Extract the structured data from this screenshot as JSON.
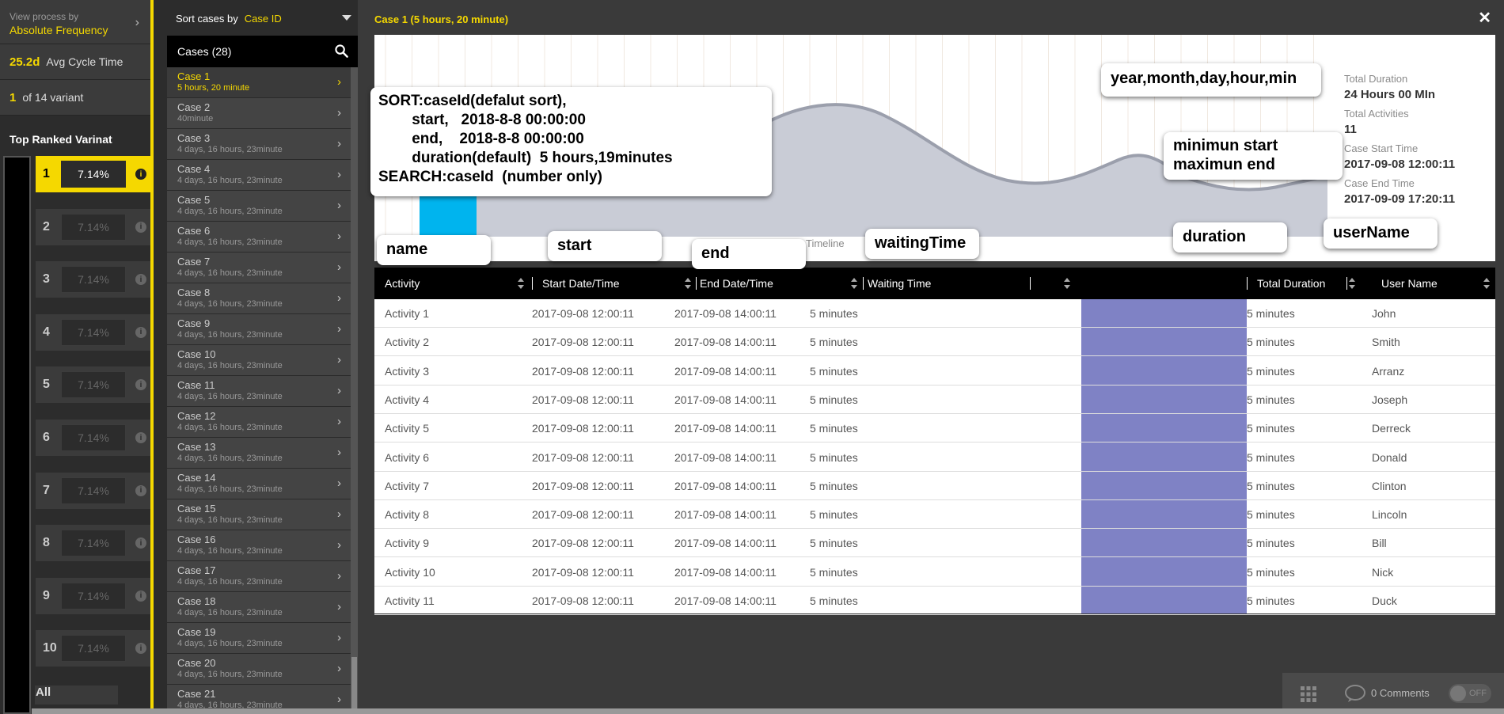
{
  "left": {
    "view_label": "View process by",
    "view_value": "Absolute Frequency",
    "avg_value": "25.2d",
    "avg_label": "Avg Cycle Time",
    "variant_num": "1",
    "variant_label": "of 14 variant",
    "top_ranked": "Top Ranked Varinat",
    "ranks": [
      {
        "n": "1",
        "pct": "7.14%"
      },
      {
        "n": "2",
        "pct": "7.14%"
      },
      {
        "n": "3",
        "pct": "7.14%"
      },
      {
        "n": "4",
        "pct": "7.14%"
      },
      {
        "n": "5",
        "pct": "7.14%"
      },
      {
        "n": "6",
        "pct": "7.14%"
      },
      {
        "n": "7",
        "pct": "7.14%"
      },
      {
        "n": "8",
        "pct": "7.14%"
      },
      {
        "n": "9",
        "pct": "7.14%"
      },
      {
        "n": "10",
        "pct": "7.14%"
      }
    ],
    "all_label": "All",
    "info_glyph": "i"
  },
  "cases": {
    "sort_label": "Sort cases by",
    "sort_value": "Case ID",
    "header": "Cases (28)",
    "items": [
      {
        "name": "Case 1",
        "dur": "5 hours, 20 minute"
      },
      {
        "name": "Case 2",
        "dur": "40minute"
      },
      {
        "name": "Case 3",
        "dur": "4 days, 16 hours, 23minute"
      },
      {
        "name": "Case 4",
        "dur": "4 days, 16 hours, 23minute"
      },
      {
        "name": "Case 5",
        "dur": "4 days, 16 hours, 23minute"
      },
      {
        "name": "Case 6",
        "dur": "4 days, 16 hours, 23minute"
      },
      {
        "name": "Case 7",
        "dur": "4 days, 16 hours, 23minute"
      },
      {
        "name": "Case 8",
        "dur": "4 days, 16 hours, 23minute"
      },
      {
        "name": "Case 9",
        "dur": "4 days, 16 hours, 23minute"
      },
      {
        "name": "Case 10",
        "dur": "4 days, 16 hours, 23minute"
      },
      {
        "name": "Case 11",
        "dur": "4 days, 16 hours, 23minute"
      },
      {
        "name": "Case 12",
        "dur": "4 days, 16 hours, 23minute"
      },
      {
        "name": "Case 13",
        "dur": "4 days, 16 hours, 23minute"
      },
      {
        "name": "Case 14",
        "dur": "4 days, 16 hours, 23minute"
      },
      {
        "name": "Case 15",
        "dur": "4 days, 16 hours, 23minute"
      },
      {
        "name": "Case 16",
        "dur": "4 days, 16 hours, 23minute"
      },
      {
        "name": "Case 17",
        "dur": "4 days, 16 hours, 23minute"
      },
      {
        "name": "Case 18",
        "dur": "4 days, 16 hours, 23minute"
      },
      {
        "name": "Case 19",
        "dur": "4 days, 16 hours, 23minute"
      },
      {
        "name": "Case 20",
        "dur": "4 days, 16 hours, 23minute"
      },
      {
        "name": "Case 21",
        "dur": "4 days, 16 hours, 23minute"
      }
    ],
    "arrow": "›"
  },
  "main": {
    "title": "Case 1 (5 hours, 20 minute)",
    "close": "✕",
    "timeline_label": "Timeline",
    "stats": [
      {
        "label": "Total Duration",
        "value": "24 Hours 00 MIn"
      },
      {
        "label": "Total Activities",
        "value": "11"
      },
      {
        "label": "Case Start Time",
        "value": "2017-09-08 12:00:11"
      },
      {
        "label": "Case End Time",
        "value": "2017-09-09 17:20:11"
      }
    ]
  },
  "annotations": {
    "sort_note": "SORT:caseId(defalut sort),\n        start,   2018-8-8 00:00:00\n        end,    2018-8-8 00:00:00\n        duration(default)  5 hours,19minutes\nSEARCH:caseId  (number only)",
    "format": "year,month,day,hour,min",
    "minmax": "minimun start\nmaximun end",
    "name": "name",
    "start": "start",
    "end": "end",
    "waiting": "waitingTime",
    "duration": "duration",
    "user": "userName"
  },
  "table": {
    "headers": {
      "activity": "Activity",
      "start": "Start Date/Time",
      "end": "End Date/Time",
      "waiting": "Waiting Time",
      "total": "Total Duration",
      "user": "User Name"
    },
    "rows": [
      {
        "activity": "Activity 1",
        "start": "2017-09-08 12:00:11",
        "end": "2017-09-08 14:00:11",
        "waiting": "5 minutes",
        "total": "5 minutes",
        "user": "John"
      },
      {
        "activity": "Activity 2",
        "start": "2017-09-08 12:00:11",
        "end": "2017-09-08 14:00:11",
        "waiting": "5 minutes",
        "total": "5 minutes",
        "user": "Smith"
      },
      {
        "activity": "Activity 3",
        "start": "2017-09-08 12:00:11",
        "end": "2017-09-08 14:00:11",
        "waiting": "5 minutes",
        "total": "5 minutes",
        "user": "Arranz"
      },
      {
        "activity": "Activity 4",
        "start": "2017-09-08 12:00:11",
        "end": "2017-09-08 14:00:11",
        "waiting": "5 minutes",
        "total": "5 minutes",
        "user": "Joseph"
      },
      {
        "activity": "Activity 5",
        "start": "2017-09-08 12:00:11",
        "end": "2017-09-08 14:00:11",
        "waiting": "5 minutes",
        "total": "5 minutes",
        "user": "Derreck"
      },
      {
        "activity": "Activity 6",
        "start": "2017-09-08 12:00:11",
        "end": "2017-09-08 14:00:11",
        "waiting": "5 minutes",
        "total": "5 minutes",
        "user": "Donald"
      },
      {
        "activity": "Activity 7",
        "start": "2017-09-08 12:00:11",
        "end": "2017-09-08 14:00:11",
        "waiting": "5 minutes",
        "total": "5 minutes",
        "user": "Clinton"
      },
      {
        "activity": "Activity 8",
        "start": "2017-09-08 12:00:11",
        "end": "2017-09-08 14:00:11",
        "waiting": "5 minutes",
        "total": "5 minutes",
        "user": "Lincoln"
      },
      {
        "activity": "Activity 9",
        "start": "2017-09-08 12:00:11",
        "end": "2017-09-08 14:00:11",
        "waiting": "5 minutes",
        "total": "5 minutes",
        "user": "Bill"
      },
      {
        "activity": "Activity 10",
        "start": "2017-09-08 12:00:11",
        "end": "2017-09-08 14:00:11",
        "waiting": "5 minutes",
        "total": "5 minutes",
        "user": "Nick"
      },
      {
        "activity": "Activity 11",
        "start": "2017-09-08 12:00:11",
        "end": "2017-09-08 14:00:11",
        "waiting": "5 minutes",
        "total": "5 minutes",
        "user": "Duck"
      }
    ]
  },
  "footer": {
    "comments": "0 Comments",
    "toggle": "OFF"
  },
  "colors": {
    "accent": "#f5d800",
    "purple": "#7f82c5",
    "cyan": "#00b4ee",
    "wave": "#c9ccd6"
  }
}
